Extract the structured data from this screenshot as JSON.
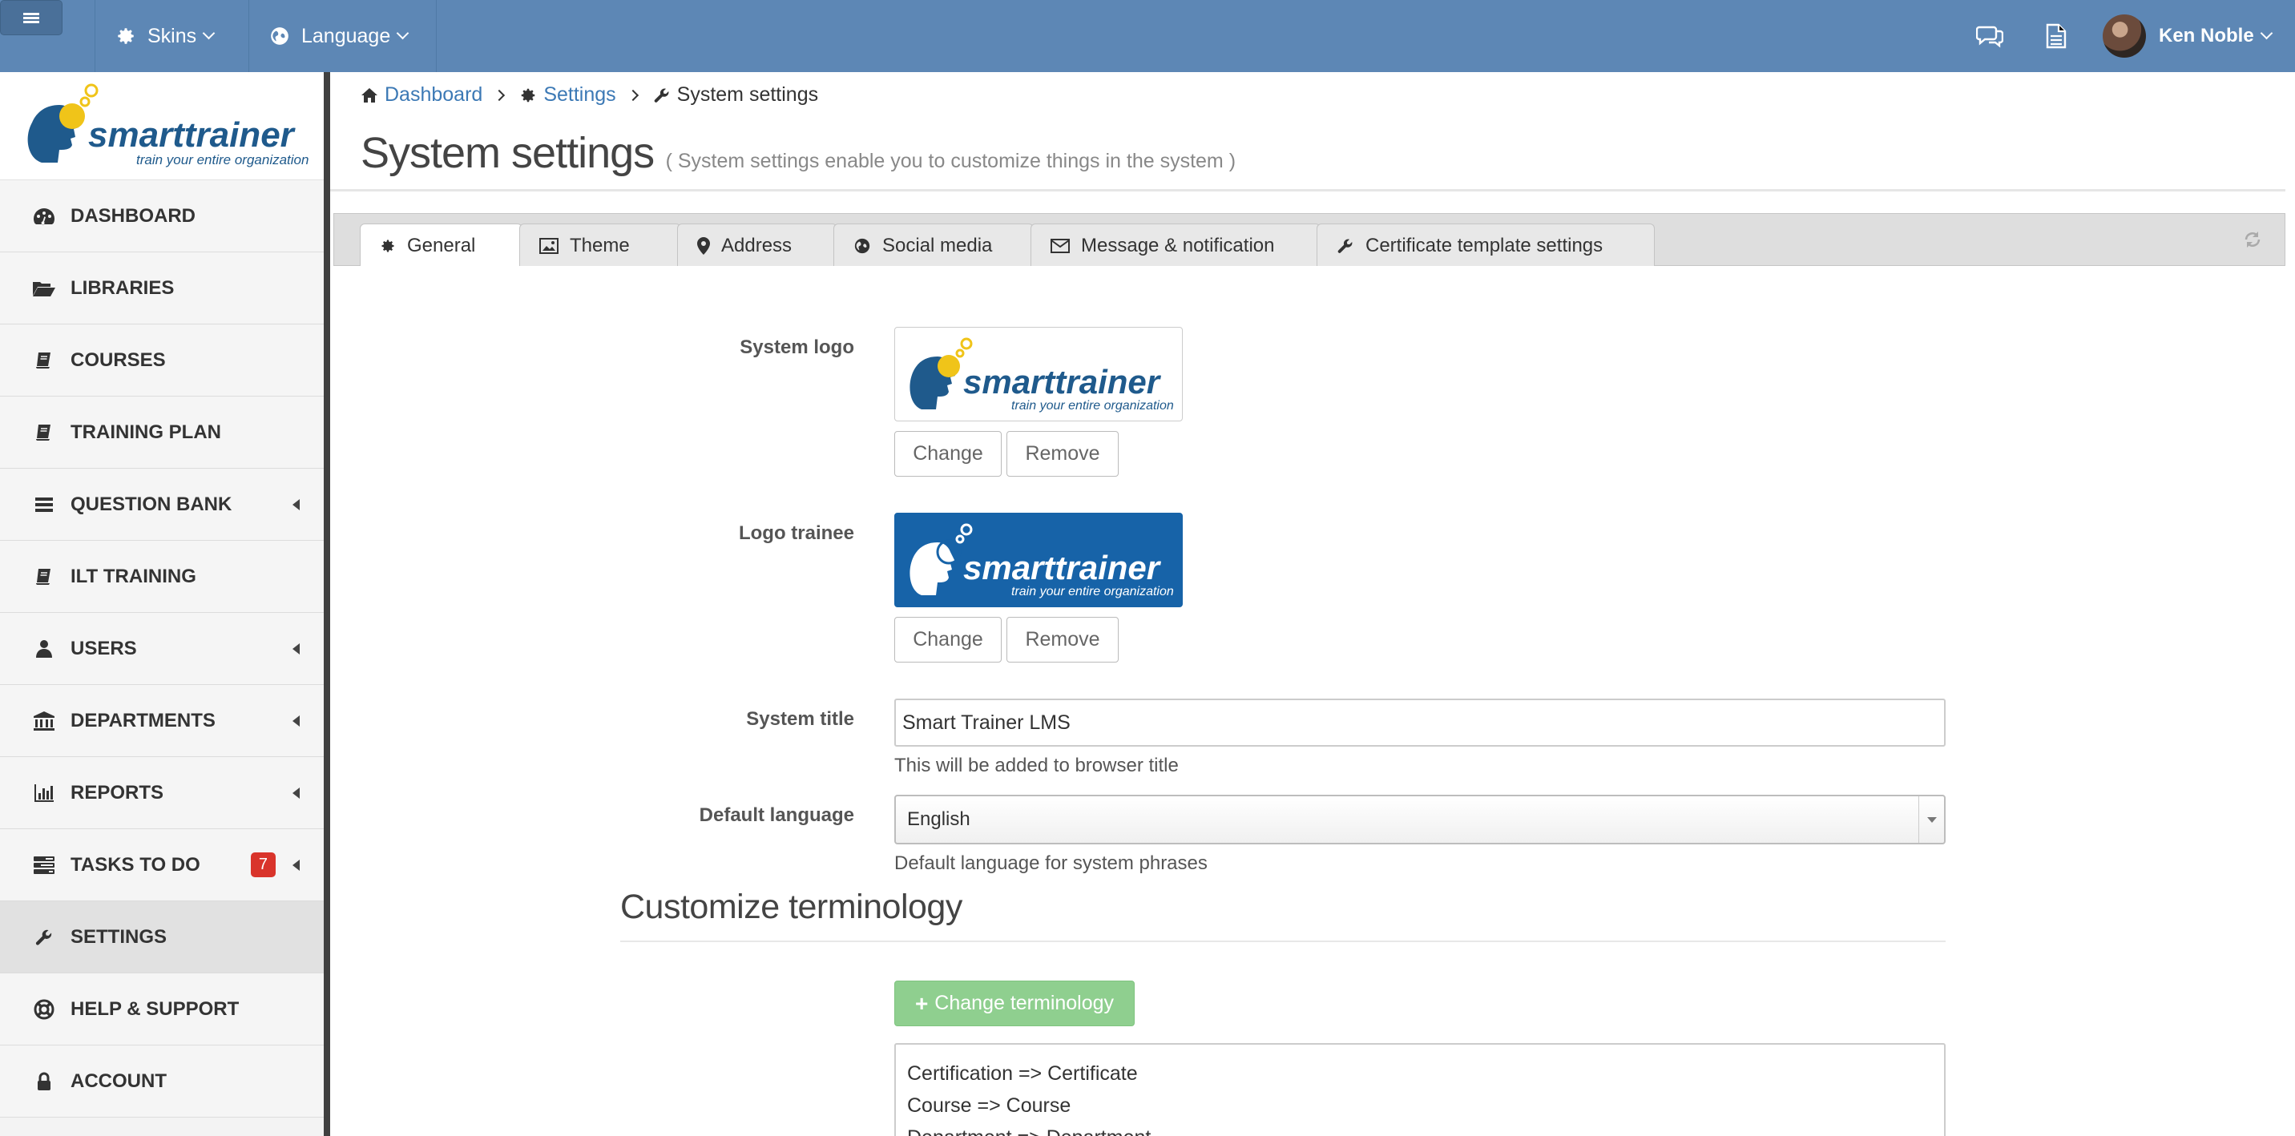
{
  "topbar": {
    "skins_label": "Skins",
    "language_label": "Language",
    "user_name": "Ken Noble"
  },
  "brand": {
    "name": "smarttrainer",
    "tagline": "train your entire organization",
    "primary_color": "#1f5a8c",
    "accent_color": "#f0c419"
  },
  "sidebar": {
    "items": [
      {
        "label": "DASHBOARD",
        "icon": "dashboard-icon"
      },
      {
        "label": "LIBRARIES",
        "icon": "folder-open-icon"
      },
      {
        "label": "COURSES",
        "icon": "book-icon"
      },
      {
        "label": "TRAINING PLAN",
        "icon": "book-icon"
      },
      {
        "label": "QUESTION BANK",
        "icon": "list-icon"
      },
      {
        "label": "ILT TRAINING",
        "icon": "book-icon"
      },
      {
        "label": "USERS",
        "icon": "user-icon"
      },
      {
        "label": "DEPARTMENTS",
        "icon": "institution-icon"
      },
      {
        "label": "REPORTS",
        "icon": "bar-chart-icon"
      },
      {
        "label": "TASKS TO DO",
        "icon": "tasks-icon",
        "badge": "7"
      },
      {
        "label": "SETTINGS",
        "icon": "wrench-icon",
        "active": true
      },
      {
        "label": "HELP & SUPPORT",
        "icon": "life-ring-icon"
      },
      {
        "label": "ACCOUNT",
        "icon": "lock-icon"
      }
    ]
  },
  "breadcrumb": {
    "dashboard": "Dashboard",
    "settings": "Settings",
    "current": "System settings"
  },
  "page": {
    "title": "System settings",
    "subtitle": "( System settings enable you to customize things in the system )"
  },
  "tabs": [
    {
      "label": "General",
      "icon": "gear-icon",
      "active": true
    },
    {
      "label": "Theme",
      "icon": "image-icon"
    },
    {
      "label": "Address",
      "icon": "map-marker-icon"
    },
    {
      "label": "Social media",
      "icon": "globe-icon"
    },
    {
      "label": "Message & notification",
      "icon": "envelope-icon"
    },
    {
      "label": "Certificate template settings",
      "icon": "wrench-icon"
    }
  ],
  "form": {
    "system_logo_label": "System logo",
    "logo_trainee_label": "Logo trainee",
    "change_label": "Change",
    "remove_label": "Remove",
    "system_title_label": "System title",
    "system_title_value": "Smart Trainer LMS",
    "system_title_help": "This will be added to browser title",
    "default_language_label": "Default language",
    "default_language_value": "English",
    "default_language_help": "Default language for system phrases"
  },
  "terminology": {
    "section_title": "Customize terminology",
    "button_label": "Change terminology",
    "lines": [
      "Certification => Certificate",
      "Course => Course",
      "Department => Department"
    ]
  }
}
